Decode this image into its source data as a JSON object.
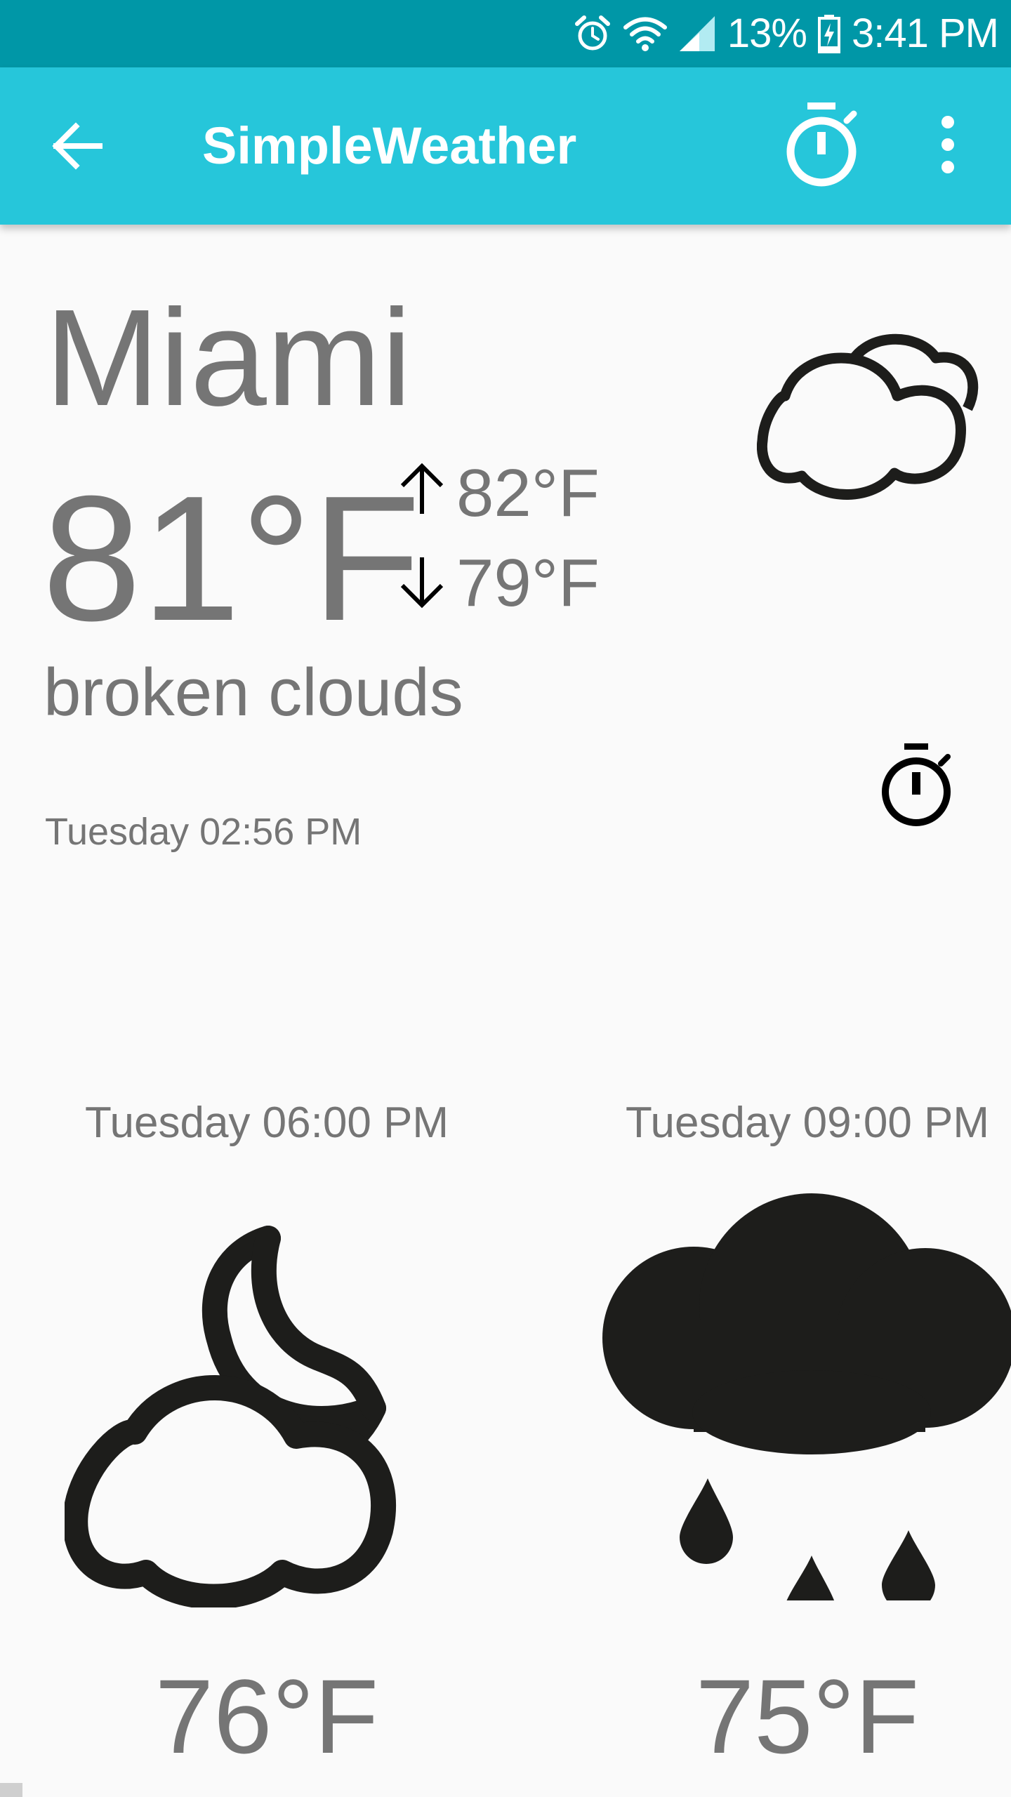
{
  "status_bar": {
    "battery": "13%",
    "time": "3:41 PM",
    "icons": [
      "alarm-icon",
      "wifi-icon",
      "signal-icon",
      "battery-charging-icon"
    ]
  },
  "app_bar": {
    "title": "SimpleWeather",
    "icons": [
      "back-arrow-icon",
      "stopwatch-icon",
      "more-vert-icon"
    ],
    "background": "#26c6da",
    "status_background": "#0097a7"
  },
  "current": {
    "city": "Miami",
    "temperature": "81°F",
    "high": "82°F",
    "low": "79°F",
    "description": "broken clouds",
    "updated": "Tuesday 02:56 PM",
    "icon": "broken-clouds-icon"
  },
  "forecast": [
    {
      "time": "Tuesday 06:00 PM",
      "temperature": "76°F",
      "icon": "night-partly-cloudy-icon"
    },
    {
      "time": "Tuesday 09:00 PM",
      "temperature": "75°F",
      "icon": "rain-icon"
    }
  ],
  "colors": {
    "text_gray": "#757575",
    "icon_dark": "#1d1d1b",
    "page_background": "#fafafa"
  }
}
